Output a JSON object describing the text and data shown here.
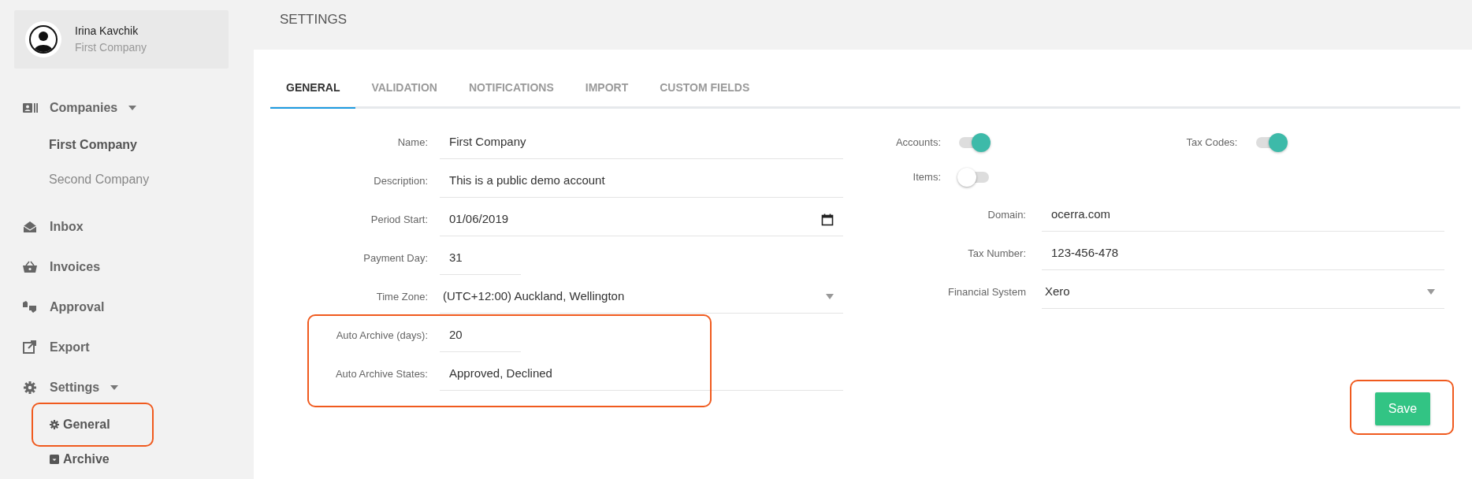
{
  "user": {
    "name": "Irina Kavchik",
    "company": "First Company"
  },
  "sidebar": {
    "items": [
      {
        "label": "Companies",
        "expanded": true,
        "children": [
          {
            "label": "First Company",
            "selected": true,
            "highlighted": false
          },
          {
            "label": "Second Company",
            "selected": false,
            "highlighted": false
          }
        ]
      },
      {
        "label": "Inbox"
      },
      {
        "label": "Invoices"
      },
      {
        "label": "Approval"
      },
      {
        "label": "Export"
      },
      {
        "label": "Settings",
        "expanded": true,
        "children": [
          {
            "label": "General",
            "kind": "icon-link",
            "selected": true,
            "highlighted": true
          },
          {
            "label": "Archive",
            "kind": "icon-link",
            "selected": true,
            "highlighted": false
          }
        ]
      }
    ]
  },
  "page_title": "SETTINGS",
  "tabs": [
    {
      "label": "GENERAL",
      "selected": true
    },
    {
      "label": "VALIDATION",
      "selected": false
    },
    {
      "label": "NOTIFICATIONS",
      "selected": false
    },
    {
      "label": "IMPORT",
      "selected": false
    },
    {
      "label": "CUSTOM FIELDS",
      "selected": false
    }
  ],
  "field_groups": [
    {
      "highlighted": false,
      "fields": [
        {
          "label": "Name:",
          "value": "First Company",
          "kind": "text"
        },
        {
          "label": "Description:",
          "value": "This is a public demo account",
          "kind": "text"
        },
        {
          "label": "Period Start:",
          "value": "01/06/2019",
          "kind": "date"
        },
        {
          "label": "Payment Day:",
          "value": "31",
          "kind": "number"
        },
        {
          "label": "Time Zone:",
          "value": "(UTC+12:00) Auckland, Wellington",
          "kind": "select"
        }
      ]
    },
    {
      "highlighted": true,
      "fields": [
        {
          "label": "Auto Archive (days):",
          "value": "20",
          "kind": "number"
        },
        {
          "label": "Auto Archive States:",
          "value": "Approved, Declined",
          "kind": "text"
        }
      ]
    }
  ],
  "toggles": [
    {
      "label": "Accounts:",
      "on": true
    },
    {
      "label": "Tax Codes:",
      "on": true
    },
    {
      "label": "Items:",
      "on": false
    }
  ],
  "right_fields": [
    {
      "label": "Domain:",
      "value": "ocerra.com",
      "kind": "text"
    },
    {
      "label": "Tax Number:",
      "value": "123-456-478",
      "kind": "text"
    },
    {
      "label": "Financial System",
      "value": "Xero",
      "kind": "select"
    }
  ],
  "save_button": {
    "label": "Save",
    "highlighted": true
  }
}
